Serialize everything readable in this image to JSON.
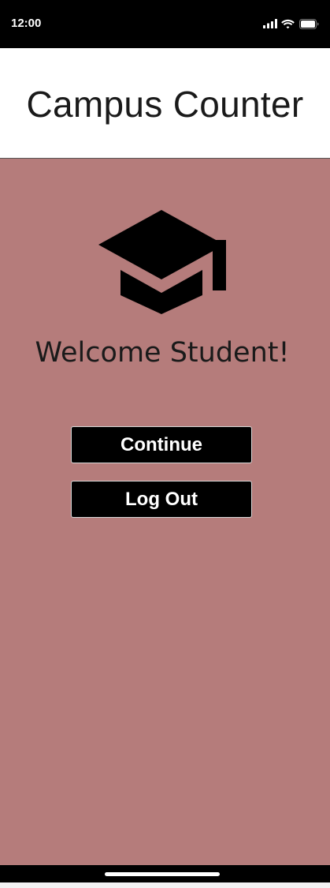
{
  "status_bar": {
    "time": "12:00",
    "icons": [
      "cellular-signal-icon",
      "wifi-icon",
      "battery-icon"
    ]
  },
  "header": {
    "title": "Campus Counter"
  },
  "main": {
    "icon": "graduation-cap-icon",
    "welcome_text": "Welcome Student!",
    "continue_label": "Continue",
    "logout_label": "Log Out"
  },
  "colors": {
    "background": "#b57c7b",
    "button_bg": "#000000",
    "button_text": "#ffffff",
    "header_bg": "#ffffff"
  }
}
